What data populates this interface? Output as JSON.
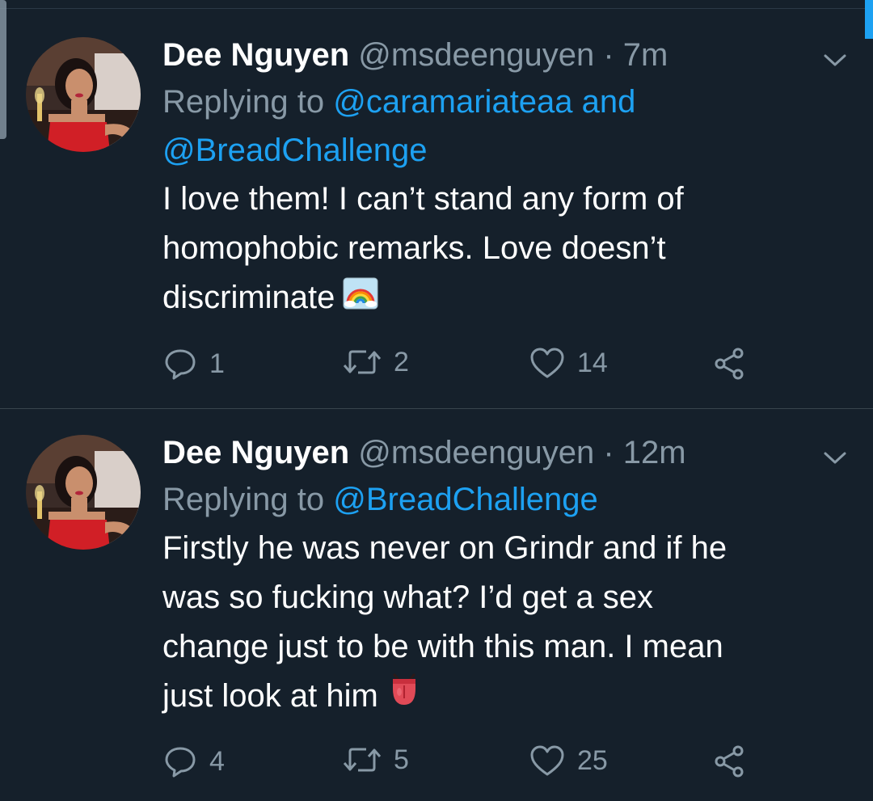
{
  "tweets": [
    {
      "name": "Dee Nguyen",
      "handle": "@msdeenguyen",
      "separator": "·",
      "time": "7m",
      "replying_prefix": "Replying to",
      "replying_to": [
        "@caramariateaa",
        "@BreadChallenge"
      ],
      "replying_conj": "and",
      "text_lines": [
        "I love them! I can’t stand any form of",
        "homophobic remarks. Love doesn’t",
        "discriminate"
      ],
      "emoji": "rainbow-emoji",
      "replies": "1",
      "retweets": "2",
      "likes": "14"
    },
    {
      "name": "Dee Nguyen",
      "handle": "@msdeenguyen",
      "separator": "·",
      "time": "12m",
      "replying_prefix": "Replying to",
      "replying_to": [
        "@BreadChallenge"
      ],
      "text_lines": [
        "Firstly he was never on Grindr and if he",
        "was so fucking what? I’d get a sex",
        "change just to be with this man. I mean",
        "just look at him"
      ],
      "emoji": "tongue-emoji",
      "replies": "4",
      "retweets": "5",
      "likes": "25"
    }
  ],
  "colors": {
    "background": "#15202b",
    "accent": "#1da1f2",
    "secondary_text": "#8899a6"
  },
  "icons": [
    "reply-icon",
    "retweet-icon",
    "like-icon",
    "share-icon",
    "chevron-down-icon"
  ]
}
